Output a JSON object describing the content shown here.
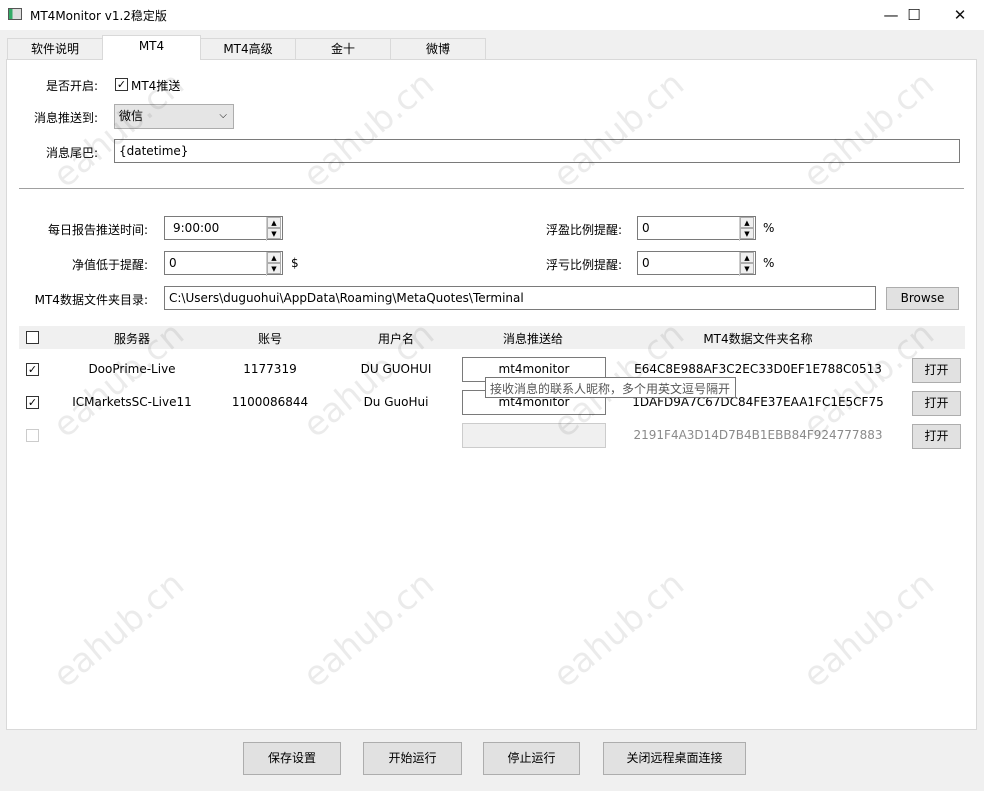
{
  "window": {
    "title": "MT4Monitor v1.2稳定版",
    "minimize": "—",
    "maximize": "☐",
    "close": "✕"
  },
  "tabs": [
    "软件说明",
    "MT4",
    "MT4高级",
    "金十",
    "微博"
  ],
  "form": {
    "enable_label": "是否开启:",
    "enable_checkbox": "MT4推送",
    "enable_checked": true,
    "push_to_label": "消息推送到:",
    "push_to_value": "微信",
    "tail_label": "消息尾巴:",
    "tail_value": "{datetime}",
    "daily_report_label": "每日报告推送时间:",
    "daily_report_value": "9:00:00",
    "equity_label": "净值低于提醒:",
    "equity_value": "0",
    "equity_unit": "$",
    "profit_label": "浮盈比例提醒:",
    "profit_value": "0",
    "profit_unit": "%",
    "loss_label": "浮亏比例提醒:",
    "loss_value": "0",
    "loss_unit": "%",
    "folder_label": "MT4数据文件夹目录:",
    "folder_value": "C:\\Users\\duguohui\\AppData\\Roaming\\MetaQuotes\\Terminal",
    "browse": "Browse"
  },
  "table": {
    "headers": [
      "服务器",
      "账号",
      "用户名",
      "消息推送给",
      "MT4数据文件夹名称"
    ],
    "rows": [
      {
        "checked": true,
        "server": "DooPrime-Live",
        "account": "1177319",
        "user": "DU GUOHUI",
        "push_to": "mt4monitor",
        "folder": "E64C8E988AF3C2EC33D0EF1E788C0513",
        "open": "打开"
      },
      {
        "checked": true,
        "server": "ICMarketsSC-Live11",
        "account": "1100086844",
        "user": "Du GuoHui",
        "push_to": "mt4monitor",
        "folder": "1DAFD9A7C67DC84FE37EAA1FC1E5CF75",
        "open": "打开"
      },
      {
        "checked": false,
        "server": "",
        "account": "",
        "user": "",
        "push_to": "",
        "folder": "2191F4A3D14D7B4B1EBB84F924777883",
        "open": "打开"
      }
    ]
  },
  "tooltip": "接收消息的联系人昵称，多个用英文逗号隔开",
  "buttons": {
    "save": "保存设置",
    "start": "开始运行",
    "stop": "停止运行",
    "close_rdp": "关闭远程桌面连接"
  },
  "watermark": "eahub.cn"
}
